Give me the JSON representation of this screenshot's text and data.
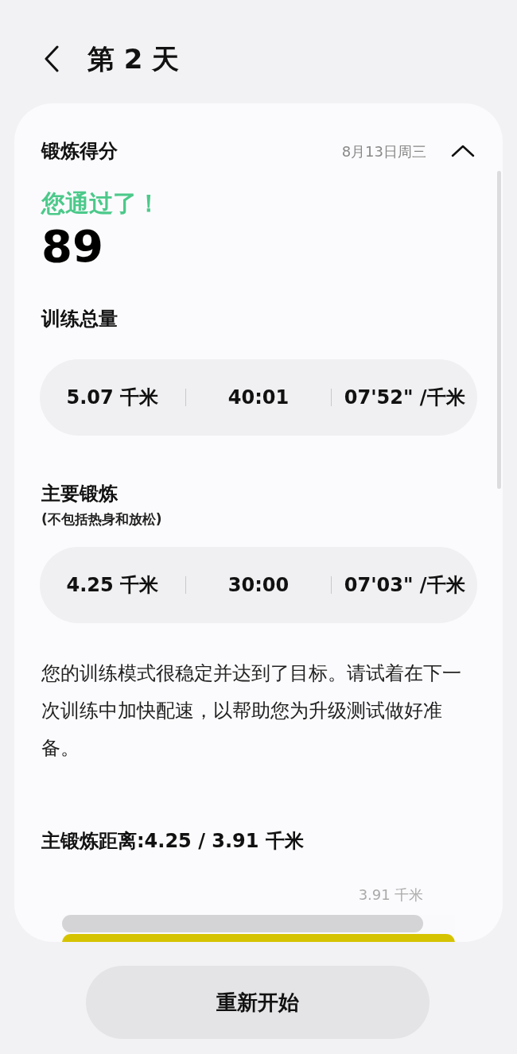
{
  "header": {
    "title": "第 2 天"
  },
  "score_card": {
    "title": "锻炼得分",
    "date": "8月13日周三",
    "expanded": true,
    "result": "您通过了！",
    "score": "89",
    "sections": [
      {
        "title": "训练总量",
        "stats": [
          "5.07 千米",
          "40:01",
          "07'52\" /千米"
        ]
      },
      {
        "title": "主要锻炼",
        "note": "(不包括热身和放松)",
        "stats": [
          "4.25 千米",
          "30:00",
          "07'03\" /千米"
        ]
      }
    ],
    "message": "您的训练模式很稳定并达到了目标。请试着在下一次训练中加快配速，以帮助您为升级测试做好准备。",
    "distance_title": "主锻炼距离:4.25 / 3.91 千米",
    "target_label": "3.91 千米",
    "bars": [
      {
        "kind": "target",
        "level": 0.92
      },
      {
        "kind": "actual",
        "level": 1
      }
    ]
  },
  "restart_button": "重新开始"
}
